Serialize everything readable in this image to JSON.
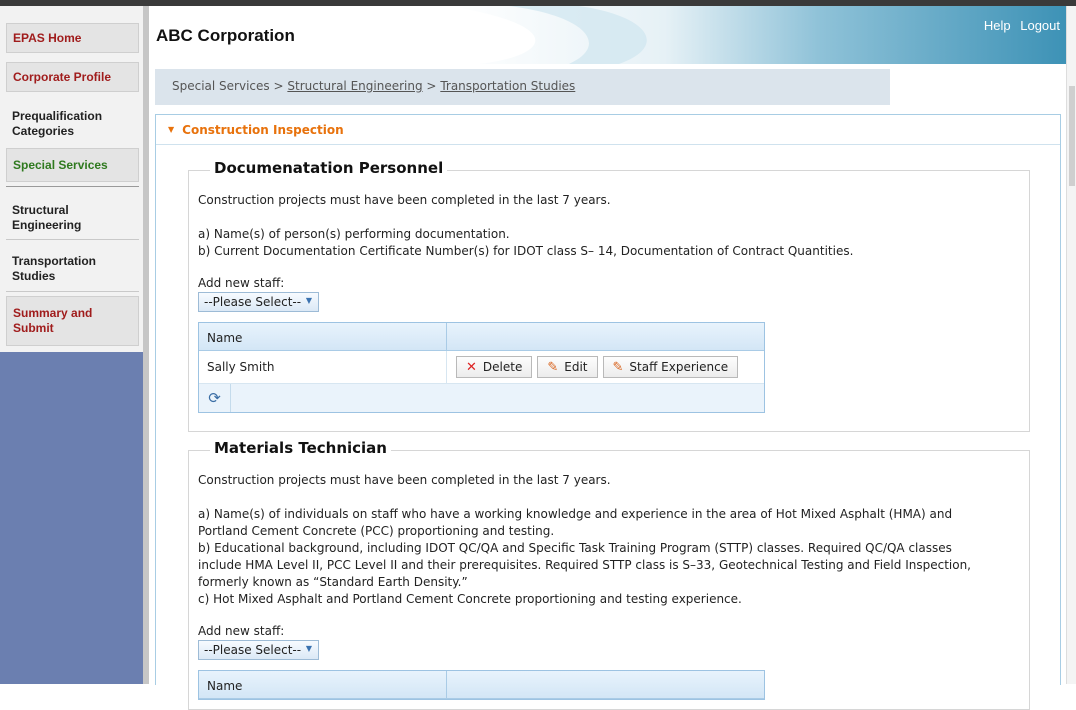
{
  "sidebar": {
    "items": [
      {
        "label": "EPAS Home"
      },
      {
        "label": "Corporate Profile"
      },
      {
        "label": "Prequalification Categories"
      },
      {
        "label": "Special Services"
      },
      {
        "label": "Structural Engineering"
      },
      {
        "label": "Transportation Studies"
      },
      {
        "label": "Summary and Submit"
      }
    ]
  },
  "header": {
    "company": "ABC Corporation",
    "links": {
      "help": "Help",
      "logout": "Logout"
    }
  },
  "breadcrumb": {
    "root": "Special Services",
    "sep": ">",
    "level1": "Structural Engineering",
    "level2": "Transportation Studies"
  },
  "panel": {
    "title": "Construction Inspection"
  },
  "sections": [
    {
      "title": "Documenatation Personnel",
      "intro": "Construction projects must have been completed in the last 7 years.",
      "req_a": "a) Name(s) of person(s) performing documentation.",
      "req_b": "b) Current Documentation Certificate Number(s) for IDOT class S– 14, Documentation of Contract Quantities.",
      "add_label": "Add new staff:",
      "select_value": "--Please Select--",
      "grid": {
        "col_name": "Name",
        "rows": [
          {
            "name": "Sally Smith"
          }
        ],
        "actions": {
          "delete": "Delete",
          "edit": "Edit",
          "experience": "Staff Experience"
        }
      }
    },
    {
      "title": "Materials Technician",
      "intro": "Construction projects must have been completed in the last 7 years.",
      "req_a1": "a) Name(s) of individuals on staff who have a working knowledge and experience in the area of Hot Mixed Asphalt (HMA) and",
      "req_a2": "Portland Cement Concrete (PCC) proportioning and testing.",
      "req_b1": "b) Educational background, including IDOT QC/QA and Specific Task Training Program (STTP) classes. Required QC/QA classes",
      "req_b2": "include HMA Level II, PCC Level II and their prerequisites. Required STTP class is S–33, Geotechnical Testing and Field Inspection,",
      "req_b3": "formerly known as “Standard Earth Density.”",
      "req_c": "c) Hot Mixed Asphalt and Portland Cement Concrete proportioning and testing experience.",
      "add_label": "Add new staff:",
      "select_value": "--Please Select--",
      "grid": {
        "col_name": "Name"
      }
    }
  ]
}
